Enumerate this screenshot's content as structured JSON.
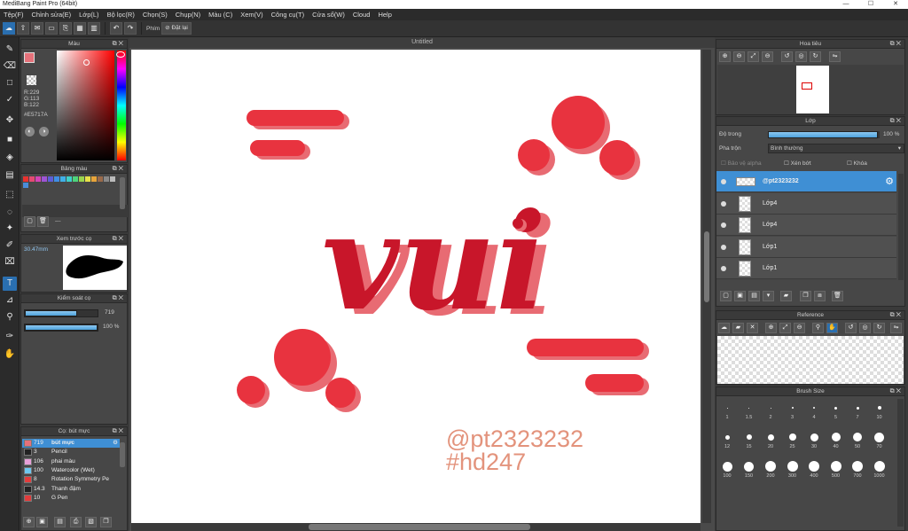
{
  "app": {
    "title": "MediBang Paint Pro (64bit)",
    "window_controls": [
      "—",
      "☐",
      "✕"
    ]
  },
  "menu": [
    "Tệp(F)",
    "Chỉnh sửa(E)",
    "Lớp(L)",
    "Bộ lọc(R)",
    "Chọn(S)",
    "Chụp(N)",
    "Màu (C)",
    "Xem(V)",
    "Công cụ(T)",
    "Cửa sổ(W)",
    "Cloud",
    "Help"
  ],
  "toolbar": {
    "shortcut_label": "Phím",
    "reset_label": "Đặt lại"
  },
  "canvas": {
    "tab_title": "Untitled",
    "word": "vui",
    "handle": "@pt2323232",
    "hashtag": "#hd247"
  },
  "color_panel": {
    "title": "Màu",
    "r": "R:229",
    "g": "G:113",
    "b": "B:122",
    "hex": "#E5717A",
    "primary": "#e5717a",
    "secondary": "#e23c3c"
  },
  "palette_panel": {
    "title": "Bảng màu",
    "more": "---",
    "colors": [
      "#e8322f",
      "#e44a73",
      "#d444b4",
      "#9d54d4",
      "#5c5ed6",
      "#3f8ee4",
      "#3fb0e8",
      "#3fd0c8",
      "#4ed47c",
      "#9ad44e",
      "#e8e04a",
      "#e8a43a",
      "#9a6a4a",
      "#888888",
      "#bbbbbb",
      "#4a8cd8"
    ]
  },
  "brush_preview": {
    "title": "Xem trước cọ",
    "size": "30.47mm"
  },
  "brush_control": {
    "title": "Kiểm soát cọ",
    "size_value": "719",
    "opacity_value": "100 %",
    "size_fraction": 0.72,
    "opacity_fraction": 1.0
  },
  "brush_list": {
    "title": "Cọ: bút mực",
    "items": [
      {
        "size": "719",
        "name": "bút mực",
        "color": "#e5717a",
        "selected": true
      },
      {
        "size": "3",
        "name": "Pencil",
        "color": "#222222",
        "selected": false
      },
      {
        "size": "106",
        "name": "phai màu",
        "color": "#e8a0d8",
        "selected": false
      },
      {
        "size": "100",
        "name": "Watercolor (Wet)",
        "color": "#6ec8f0",
        "selected": false
      },
      {
        "size": "8",
        "name": "Rotation Symmetry Pe",
        "color": "#e23c3c",
        "selected": false
      },
      {
        "size": "14.3",
        "name": "Thanh đậm",
        "color": "#222222",
        "selected": false
      },
      {
        "size": "10",
        "name": "G Pen",
        "color": "#e23c3c",
        "selected": false
      }
    ]
  },
  "navigator": {
    "title": "Hoa tiêu"
  },
  "layer_panel": {
    "title": "Lớp",
    "opacity_label": "Độ trong",
    "opacity_value": "100 %",
    "opacity_fraction": 1.0,
    "blend_label": "Pha trộn",
    "blend_value": "Bình thường",
    "alpha_lock": "Bảo vệ alpha",
    "clipping": "Xén bớt",
    "lock": "Khóa",
    "layers": [
      {
        "name": "@pt2323232",
        "selected": true
      },
      {
        "name": "Lớp4",
        "selected": false
      },
      {
        "name": "Lớp4",
        "selected": false
      },
      {
        "name": "Lớp1",
        "selected": false
      },
      {
        "name": "Lớp1",
        "selected": false
      }
    ]
  },
  "reference_panel": {
    "title": "Reference"
  },
  "brush_size_panel": {
    "title": "Brush Size",
    "rows": [
      [
        "1",
        "1.5",
        "2",
        "3",
        "4",
        "5",
        "7",
        "10"
      ],
      [
        "12",
        "15",
        "20",
        "25",
        "30",
        "40",
        "50",
        "70"
      ],
      [
        "100",
        "150",
        "200",
        "300",
        "400",
        "500",
        "700",
        "1000"
      ]
    ]
  }
}
